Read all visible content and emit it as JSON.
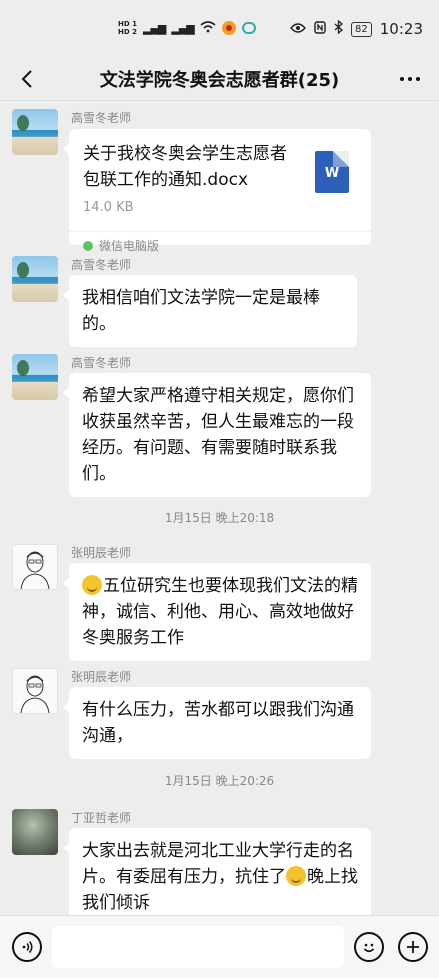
{
  "status_bar": {
    "sim1": "HD 1",
    "sim2": "HD 2",
    "battery": "82",
    "time": "10:23"
  },
  "header": {
    "title": "文法学院冬奥会志愿者群(25)"
  },
  "messages": [
    {
      "sender": "高雪冬老师",
      "type": "file",
      "file_name": "关于我校冬奥会学生志愿者包联工作的通知.docx",
      "file_size": "14.0 KB",
      "file_type_letter": "W",
      "source": "微信电脑版"
    },
    {
      "sender": "高雪冬老师",
      "text": "我相信咱们文法学院一定是最棒的。"
    },
    {
      "sender": "高雪冬老师",
      "text": "希望大家严格遵守相关规定，愿你们收获虽然辛苦，但人生最难忘的一段经历。有问题、有需要随时联系我们。"
    },
    {
      "time": "1月15日 晚上20:18"
    },
    {
      "sender": "张明辰老师",
      "text": "五位研究生也要体现我们文法的精神，诚信、利他、用心、高效地做好冬奥服务工作"
    },
    {
      "sender": "张明辰老师",
      "text": "有什么压力，苦水都可以跟我们沟通沟通，"
    },
    {
      "time": "1月15日 晚上20:26"
    },
    {
      "sender": "丁亚哲老师",
      "text_part1": "大家出去就是河北工业大学行走的名片。有委屈有压力，抗住了",
      "text_part2": "晚上找我们倾诉"
    }
  ],
  "input_bar": {
    "voice_icon": "voice-icon",
    "emoji_icon": "emoji-icon",
    "plus_icon": "plus-icon"
  }
}
